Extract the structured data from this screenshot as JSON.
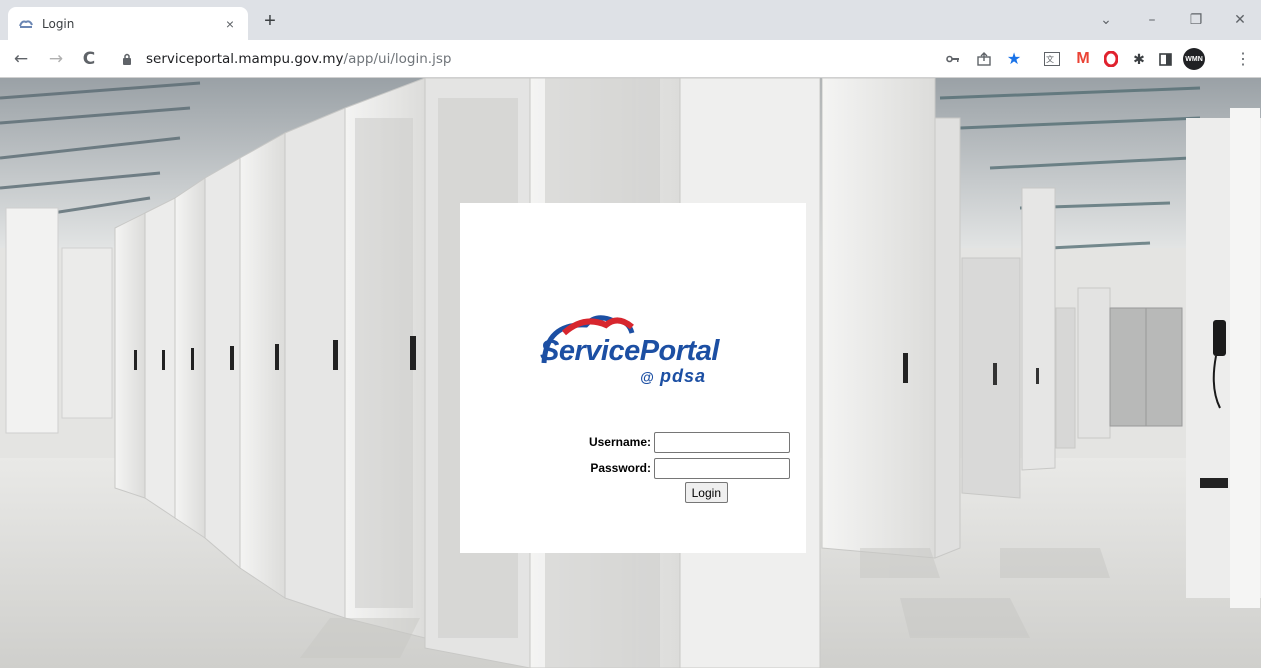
{
  "browser": {
    "tab": {
      "title": "Login",
      "close": "×"
    },
    "new_tab": "+",
    "window_controls": {
      "minimize": "–",
      "restore": "❐",
      "close": "✕",
      "tab_search": "⌄"
    },
    "nav": {
      "back": "←",
      "forward": "→",
      "reload": "C"
    },
    "url": {
      "host": "serviceportal.mampu.gov.my",
      "path": "/app/ui/login.jsp"
    },
    "extensions": [
      "key-icon",
      "share-icon",
      "star-icon",
      "translate-icon",
      "gmail-icon",
      "opera-icon",
      "puzzle-icon",
      "sidepanel-icon",
      "profile-avatar",
      "menu-icon"
    ],
    "profile_initials": "WMN",
    "menu": "⋮"
  },
  "login": {
    "logo": {
      "service_portal": "ServicePortal",
      "at": "@",
      "pdsa": "pdsa"
    },
    "username_label": "Username:",
    "password_label": "Password:",
    "username_value": "",
    "password_value": "",
    "submit_label": "Login"
  },
  "colors": {
    "logo_blue": "#1c4fa3",
    "logo_red": "#d7262e",
    "star_blue": "#1a73e8",
    "gmail_red": "#ea4335",
    "opera_red": "#e0222e"
  }
}
